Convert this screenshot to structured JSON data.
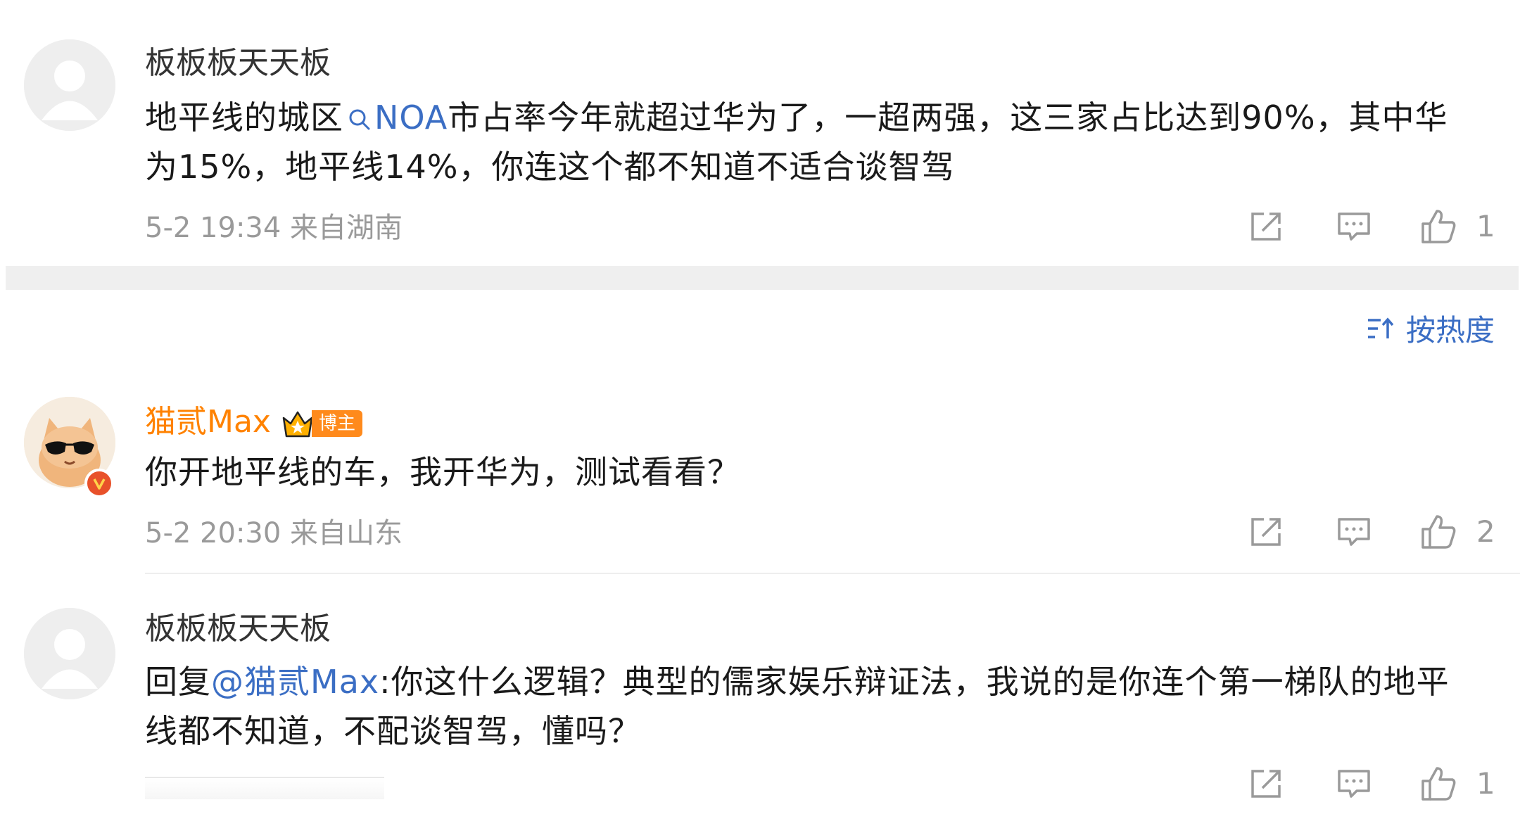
{
  "comments": [
    {
      "username": "板板板天天板",
      "text_before": "地平线的城区",
      "search_link": "NOA",
      "text_after": "市占率今年就超过华为了，一超两强，这三家占比达到90%，其中华为15%，地平线14%，你连这个都不知道不适合谈智驾",
      "meta": "5-2 19:34 来自湖南",
      "likes": "1"
    },
    {
      "username": "猫贰Max",
      "badge": "博主",
      "text": "你开地平线的车，我开华为，测试看看？",
      "meta": "5-2 20:30 来自山东",
      "likes": "2"
    },
    {
      "username": "板板板天天板",
      "reply_prefix": "回复",
      "mention": "@猫贰Max",
      "text": ":你这什么逻辑？典型的儒家娱乐辩证法，我说的是你连个第一梯队的地平线都不知道，不配谈智驾，懂吗？",
      "likes": "1"
    }
  ],
  "sort": {
    "label": "按热度",
    "icon": "sort-icon"
  },
  "icons": {
    "share": "share-icon",
    "comment": "comment-icon",
    "like": "thumbs-up-icon",
    "verified": "verified-v-icon",
    "crown": "crown-icon"
  },
  "colors": {
    "link": "#3b6ec4",
    "vip_name": "#ff8200",
    "meta": "#9a9a9a",
    "badge": "#ff8a1c"
  }
}
